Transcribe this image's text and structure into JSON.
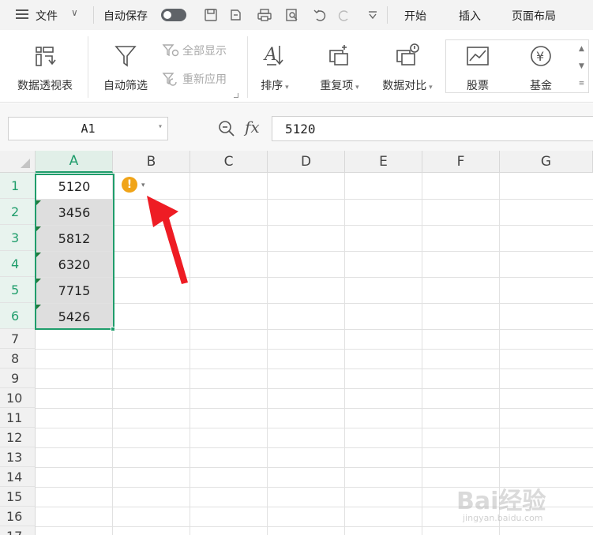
{
  "menubar": {
    "file_label": "文件",
    "autosave_label": "自动保存",
    "autosave_on": false,
    "tabs": [
      "开始",
      "插入",
      "页面布局"
    ]
  },
  "ribbon": {
    "pivot_label": "数据透视表",
    "autofilter_label": "自动筛选",
    "show_all_label": "全部显示",
    "reapply_label": "重新应用",
    "sort_label": "排序",
    "duplicates_label": "重复项",
    "compare_label": "数据对比",
    "stock_label": "股票",
    "fund_label": "基金"
  },
  "formula_bar": {
    "cell_ref": "A1",
    "value": "5120"
  },
  "grid": {
    "columns": [
      "A",
      "B",
      "C",
      "D",
      "E",
      "F",
      "G"
    ],
    "rows": [
      "1",
      "2",
      "3",
      "4",
      "5",
      "6",
      "7",
      "8",
      "9",
      "10",
      "11",
      "12",
      "13",
      "14",
      "15",
      "16",
      "17"
    ],
    "column_a_values": [
      "5120",
      "3456",
      "5812",
      "6320",
      "7715",
      "5426"
    ],
    "selected_column": "A",
    "warning_symbol": "!"
  },
  "colors": {
    "selection": "#1f9d6b",
    "warning": "#f0a419",
    "arrow": "#ee1c24"
  },
  "watermark": {
    "brand": "Bai经验",
    "url": "jingyan.baidu.com"
  }
}
